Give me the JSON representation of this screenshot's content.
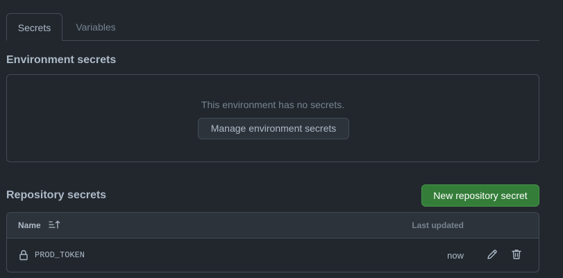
{
  "tabs": [
    {
      "label": "Secrets",
      "active": true
    },
    {
      "label": "Variables",
      "active": false
    }
  ],
  "environment": {
    "title": "Environment secrets",
    "empty_text": "This environment has no secrets.",
    "manage_button": "Manage environment secrets"
  },
  "repository": {
    "title": "Repository secrets",
    "new_button": "New repository secret",
    "columns": {
      "name": "Name",
      "last_updated": "Last updated"
    },
    "rows": [
      {
        "name": "PROD_TOKEN",
        "updated": "now"
      }
    ]
  },
  "icons": {
    "sort": "sort-ascending-icon",
    "lock": "lock-icon",
    "edit": "pencil-icon",
    "delete": "trash-icon"
  },
  "colors": {
    "background": "#22272e",
    "border": "#444c56",
    "primary_button": "#347d39",
    "text": "#adbac7",
    "muted_text": "#768390"
  }
}
